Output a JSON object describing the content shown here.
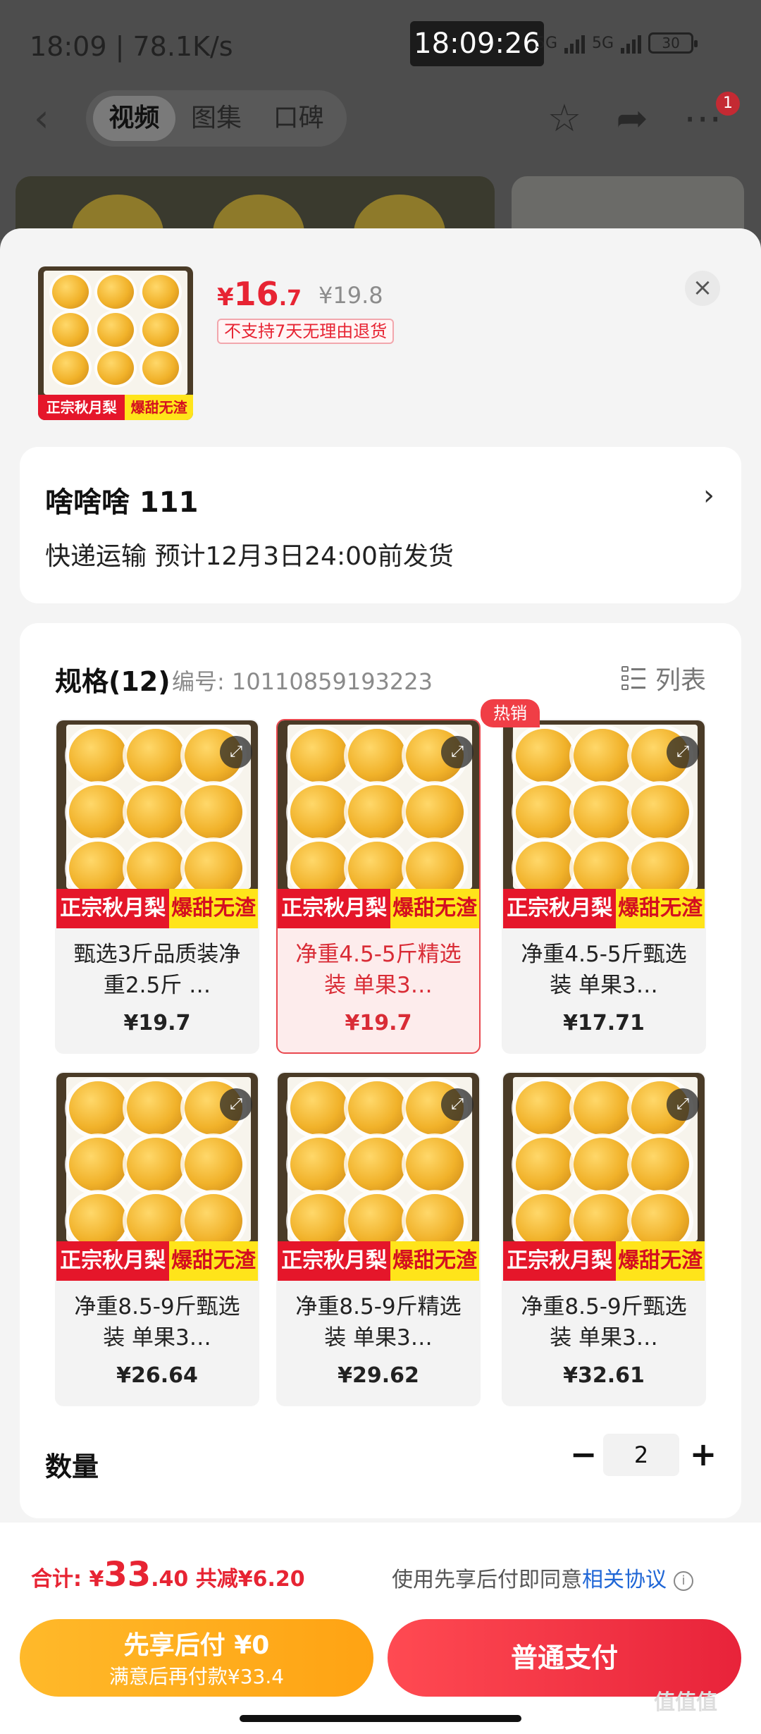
{
  "status": {
    "time_speed": "18:09 | 78.1K/s",
    "clock_overlay": "18:09:26",
    "net1": "5G",
    "net2": "5G",
    "battery": "30"
  },
  "nav": {
    "tabs": [
      "视频",
      "图集",
      "口碑"
    ],
    "active_tab": 0,
    "badge": "1"
  },
  "product": {
    "price_currency": "¥",
    "price_int": "16",
    "price_dec": ".7",
    "original_price": "¥19.8",
    "return_tag": "不支持7天无理由退货",
    "banner_left": "正宗秋月梨",
    "banner_right": "爆甜无渣"
  },
  "address": {
    "name": "啥啥啥  111",
    "shipping": "快递运输 预计12月3日24:00前发货"
  },
  "spec": {
    "title": "规格(12)",
    "code": "编号: 10110859193223",
    "list_label": "列表",
    "hot_label": "热销",
    "items": [
      {
        "title": "甄选3斤品质装净重2.5斤 …",
        "price": "¥19.7",
        "selected": false
      },
      {
        "title": "净重4.5-5斤精选装 单果3…",
        "price": "¥19.7",
        "selected": true
      },
      {
        "title": "净重4.5-5斤甄选装 单果3…",
        "price": "¥17.71",
        "selected": false
      },
      {
        "title": "净重8.5-9斤甄选装 单果3…",
        "price": "¥26.64",
        "selected": false
      },
      {
        "title": "净重8.5-9斤精选装 单果3…",
        "price": "¥29.62",
        "selected": false
      },
      {
        "title": "净重8.5-9斤甄选装 单果3…",
        "price": "¥32.61",
        "selected": false
      }
    ]
  },
  "quantity": {
    "label": "数量",
    "value": "2"
  },
  "footer": {
    "total_prefix": "合计: ¥",
    "total_int": "33",
    "total_dec": ".40",
    "discount": " 共减¥6.20",
    "agree_text": "使用先享后付即同意",
    "agree_link": "相关协议",
    "pay_later_line1": "先享后付 ¥0",
    "pay_later_line2": "满意后再付款¥33.4",
    "pay_normal": "普通支付",
    "watermark": "值值值"
  },
  "colors": {
    "accent_red": "#e72433",
    "pay_orange": "#ffa313",
    "link_blue": "#1f66d6"
  }
}
